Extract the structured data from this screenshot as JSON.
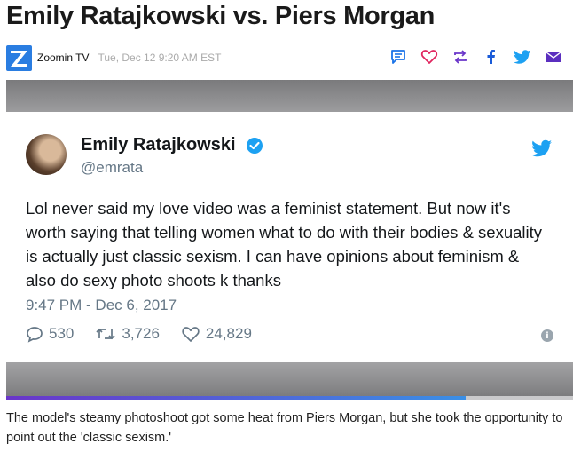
{
  "article": {
    "headline": "Emily Ratajkowski vs. Piers Morgan",
    "source": "Zoomin TV",
    "date": "Tue, Dec 12 9:20 AM EST",
    "caption": "The model's steamy photoshoot got some heat from Piers Morgan, but she took the opportunity to point out the 'classic sexism.'"
  },
  "actions": [
    {
      "name": "comment-icon",
      "color": "#1a73e8"
    },
    {
      "name": "heart-icon",
      "color": "#e0245e"
    },
    {
      "name": "share-icon",
      "color": "#6a35c9"
    },
    {
      "name": "facebook-icon",
      "color": "#1a5bd8"
    },
    {
      "name": "twitter-icon",
      "color": "#1da1f2"
    },
    {
      "name": "mail-icon",
      "color": "#5b2fbf"
    }
  ],
  "tweet": {
    "name": "Emily Ratajkowski",
    "handle": "@emrata",
    "text": "Lol never said my love video was a feminist statement. But now it's worth saying that telling women what to do with their bodies & sexuality is actually just classic sexism. I can have opinions about feminism & also do sexy photo shoots k thanks",
    "time": "9:47 PM - Dec 6, 2017",
    "replies": "530",
    "retweets": "3,726",
    "likes": "24,829",
    "info": "i"
  },
  "video": {
    "progress": 0.81
  },
  "colors": {
    "twitter_blue": "#1da1f2",
    "logo_blue": "#2a7de1"
  }
}
